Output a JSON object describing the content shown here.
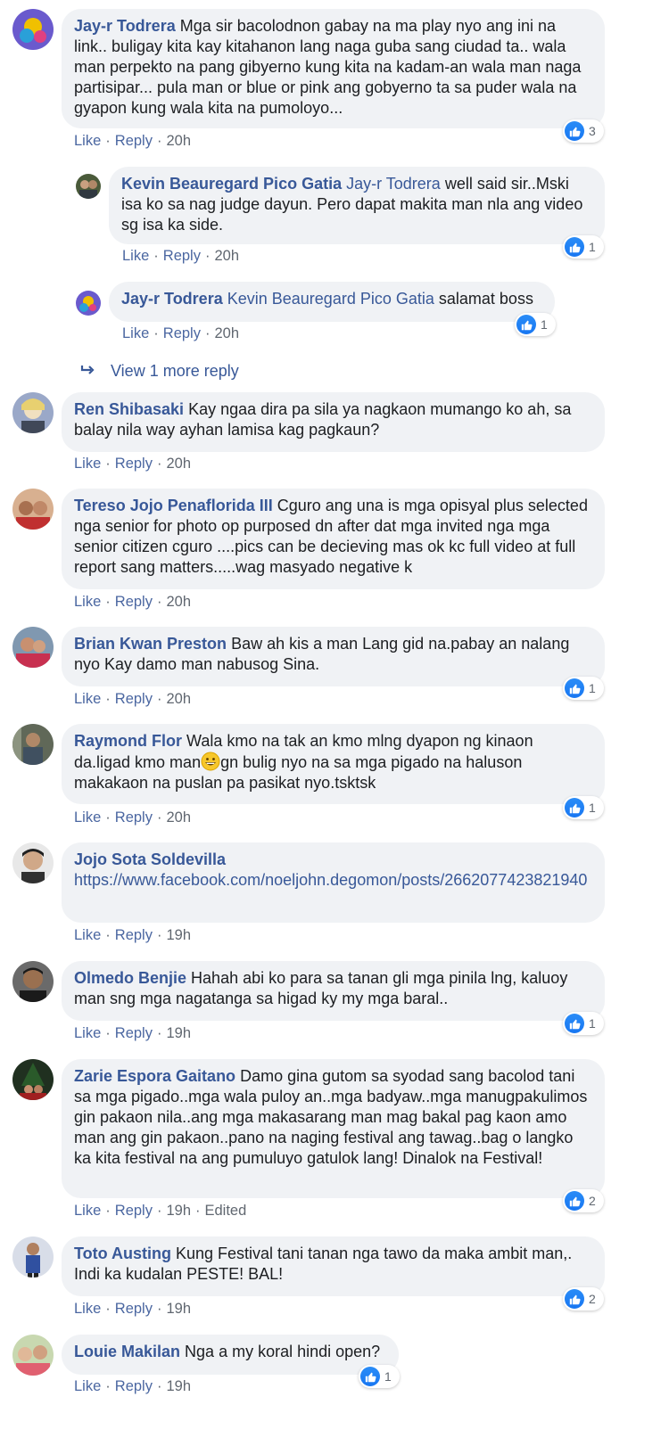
{
  "action_labels": {
    "like": "Like",
    "reply": "Reply",
    "separator": "·"
  },
  "comments": [
    {
      "author": "Jay-r Todrera",
      "mention": "",
      "text": "Mga sir bacolodnon gabay na ma play nyo ang ini na link.. buligay kita kay kitahanon lang naga guba sang ciudad ta.. wala man perpekto na pang gibyerno kung kita na kadam-an wala man naga partisipar... pula man or blue or pink ang gobyerno ta sa puder wala na gyapon kung wala kita na pumoloyo...",
      "time": "20h",
      "reactions": "3"
    },
    {
      "author": "Kevin Beauregard Pico Gatia",
      "mention": "Jay-r Todrera",
      "text": "well said sir..Mski isa ko sa nag judge dayun. Pero dapat makita man nla ang video sg isa ka side.",
      "time": "20h",
      "reactions": "1"
    },
    {
      "author": "Jay-r Todrera",
      "mention": "Kevin Beauregard Pico Gatia",
      "text": "salamat boss",
      "time": "20h",
      "reactions": "1"
    },
    {
      "author": "Ren Shibasaki",
      "mention": "",
      "text": "Kay ngaa dira pa sila ya nagkaon mumango ko ah, sa balay nila way ayhan lamisa kag pagkaun?",
      "time": "20h",
      "reactions": ""
    },
    {
      "author": "Tereso Jojo Penaflorida III",
      "mention": "",
      "text": "Cguro ang una is mga opisyal plus selected nga senior for photo op purposed dn after dat mga invited nga mga senior citizen cguro ....pics can be decieving mas ok kc full video at full report sang matters.....wag masyado negative k",
      "time": "20h",
      "reactions": ""
    },
    {
      "author": "Brian Kwan Preston",
      "mention": "",
      "text": "Baw ah kis a man Lang gid na.pabay an nalang nyo Kay damo man nabusog Sina.",
      "time": "20h",
      "reactions": "1"
    },
    {
      "author": "Raymond Flor",
      "mention": "",
      "text": "Wala kmo na tak an kmo mlng dyapon ng kinaon da.ligad kmo man",
      "text2": "gn bulig nyo na sa mga pigado na haluson makakaon na puslan pa pasikat nyo.tsktsk",
      "time": "20h",
      "reactions": "1"
    },
    {
      "author": "Jojo Sota Soldevilla",
      "mention": "",
      "link": "https://www.facebook.com/noeljohn.degomon/posts/2662077423821940",
      "time": "19h",
      "reactions": ""
    },
    {
      "author": "Olmedo Benjie",
      "mention": "",
      "text": "Hahah abi ko para sa tanan gli mga pinila lng, kaluoy man sng mga nagatanga sa higad ky my mga baral..",
      "time": "19h",
      "reactions": "1"
    },
    {
      "author": "Zarie Espora Gaitano",
      "mention": "",
      "text": "Damo gina gutom sa syodad sang bacolod tani sa mga pigado..mga wala puloy an..mga badyaw..mga manugpakulimos gin pakaon nila..ang mga makasarang man mag bakal pag kaon amo man ang gin pakaon..pano na naging festival ang tawag..bag o langko ka kita festival na ang pumuluyo gatulok lang! Dinalok na Festival!",
      "time": "19h",
      "edited": "Edited",
      "reactions": "2"
    },
    {
      "author": "Toto Austing",
      "mention": "",
      "text": "Kung Festival tani tanan nga tawo da maka ambit man,. Indi ka kudalan PESTE! BAL!",
      "time": "19h",
      "reactions": "2"
    },
    {
      "author": "Louie Makilan",
      "mention": "",
      "text": "Nga a my koral hindi open?",
      "time": "19h",
      "reactions": "1"
    }
  ],
  "view_more_replies": "View 1 more reply",
  "colors": {
    "author": "#385898",
    "bubble": "#f0f2f5",
    "like": "#1877f2",
    "meta": "#606770"
  },
  "icons": [
    "avatar-photo",
    "like-thumb-icon",
    "reply-arrow-icon",
    "grinning-emoji-icon"
  ]
}
